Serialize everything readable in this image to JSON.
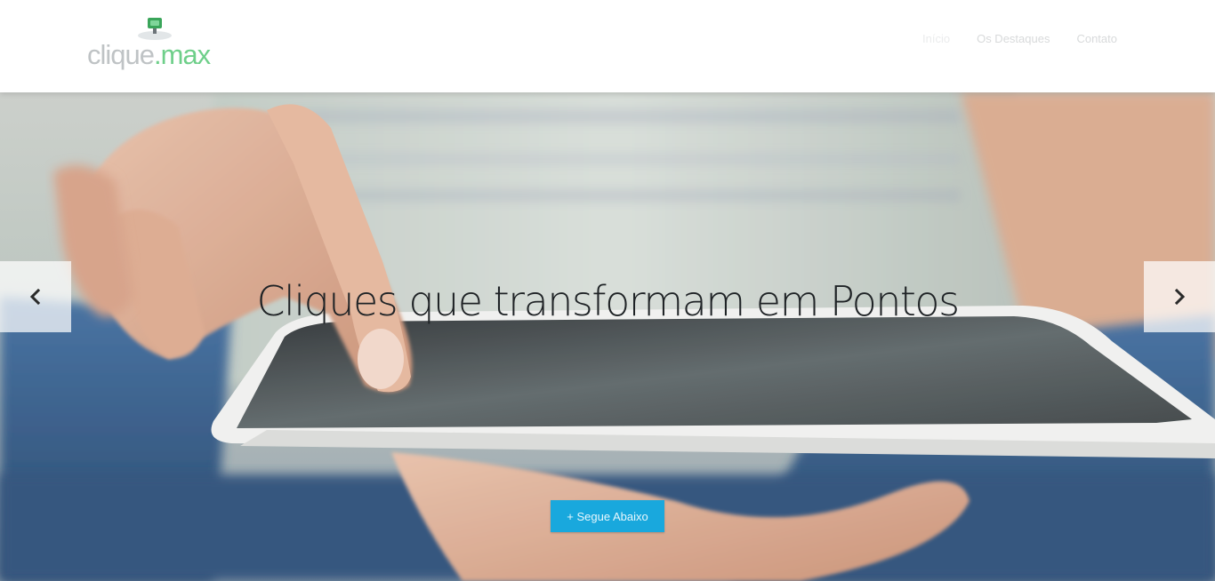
{
  "header": {
    "logo": {
      "text_main": "clique",
      "text_accent": ".max"
    },
    "nav": [
      {
        "label": "Início",
        "active": true
      },
      {
        "label": "Os Destaques",
        "active": false
      },
      {
        "label": "Contato",
        "active": false
      }
    ]
  },
  "hero": {
    "title": "Cliques que transformam em Pontos",
    "cta_label": "+ Segue Abaixo",
    "prev_icon": "chevron-left-icon",
    "next_icon": "chevron-right-icon"
  },
  "colors": {
    "accent": "#19a8dd",
    "logo_green": "#6fcf8a"
  }
}
